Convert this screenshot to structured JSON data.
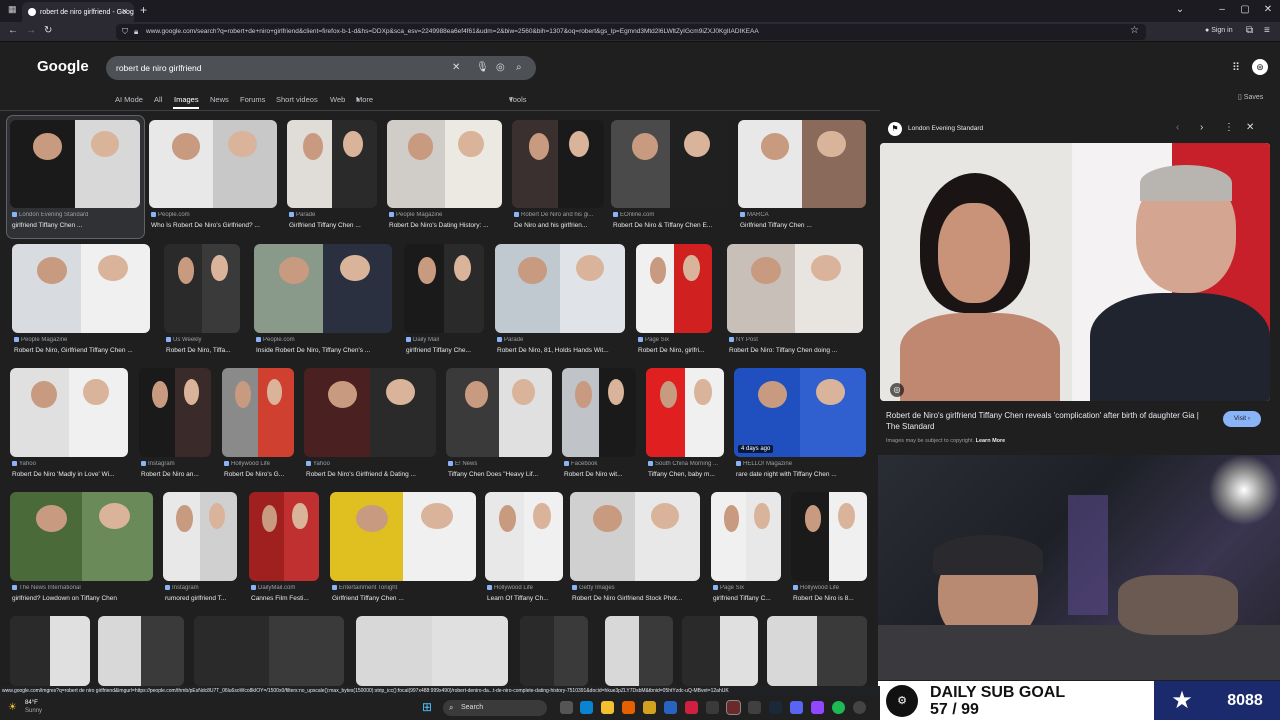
{
  "browser": {
    "tab_title": "robert de niro girlfriend - Goog",
    "url": "www.google.com/search?q=robert+de+niro+girlfriend&client=firefox-b-1-d&hs=DDXp&sca_esv=2249988ea6ef4f61&udm=2&biw=2560&bih=1307&oq=robert&gs_lp=Egmnd3Mtd2l6LWltZyIGcm9iZXJ0KgIIADIKEAA",
    "signin": "Sign in"
  },
  "google": {
    "logo": "Google",
    "query": "robert de niro girlfriend",
    "tabs": [
      "AI Mode",
      "All",
      "Images",
      "News",
      "Forums",
      "Short videos",
      "Web",
      "More"
    ],
    "active_tab": "Images",
    "tools": "Tools",
    "saves": "Saves"
  },
  "results": [
    {
      "source": "London Evening Standard",
      "caption": "girlfriend Tiffany Chen ...",
      "c1": "#1a1a1a",
      "c2": "#d8d8d8"
    },
    {
      "source": "People.com",
      "caption": "Who Is Robert De Niro's Girlfriend? ...",
      "c1": "#e8e8e8",
      "c2": "#c8c8c8"
    },
    {
      "source": "Parade",
      "caption": "Girlfriend Tiffany Chen ...",
      "c1": "#e0ddd8",
      "c2": "#2a2a2a"
    },
    {
      "source": "People Magazine",
      "caption": "Robert De Niro's Dating History: ...",
      "c1": "#d0ccc8",
      "c2": "#ece8e2"
    },
    {
      "source": "Robert De Niro and his gi...",
      "caption": "De Niro and his girlfrien...",
      "c1": "#3a3030",
      "c2": "#1a1a1a"
    },
    {
      "source": "EOnline.com",
      "caption": "Robert De Niro & Tiffany Chen E...",
      "c1": "#4a4a4a",
      "c2": "#202020"
    },
    {
      "source": "MARCA",
      "caption": "Girlfriend Tiffany Chen ...",
      "c1": "#e8e8e8",
      "c2": "#8a6a5a"
    },
    {
      "source": "People Magazine",
      "caption": "Robert De Niro, Girlfriend Tiffany Chen ...",
      "c1": "#d8dce0",
      "c2": "#f0f0f0"
    },
    {
      "source": "Us Weekly",
      "caption": "Robert De Niro, Tiffa...",
      "c1": "#2a2a2a",
      "c2": "#3a3a3a"
    },
    {
      "source": "People.com",
      "caption": "Inside Robert De Niro, Tiffany Chen's ...",
      "c1": "#8a9a8a",
      "c2": "#2a3040"
    },
    {
      "source": "Daily Mail",
      "caption": "girlfriend Tiffany Che...",
      "c1": "#1a1a1a",
      "c2": "#2a2a2a"
    },
    {
      "source": "Parade",
      "caption": "Robert De Niro, 81, Holds Hands Wit...",
      "c1": "#c0c8d0",
      "c2": "#e0e4e8"
    },
    {
      "source": "Page Six",
      "caption": "Robert De Niro, girlfri...",
      "c1": "#f0f0f0",
      "c2": "#d02020"
    },
    {
      "source": "NY Post",
      "caption": "Robert De Niro: Tiffany Chen doing ...",
      "c1": "#c8c0b8",
      "c2": "#e8e4e0"
    },
    {
      "source": "Yahoo",
      "caption": "Robert De Niro 'Madly in Love' Wi...",
      "c1": "#e0e0e0",
      "c2": "#f0f0f0"
    },
    {
      "source": "Instagram",
      "caption": "Robert De Niro an...",
      "c1": "#1a1a1a",
      "c2": "#3a2a2a"
    },
    {
      "source": "Hollywood Life",
      "caption": "Robert De Niro's G...",
      "c1": "#8a8a8a",
      "c2": "#d04030"
    },
    {
      "source": "Yahoo",
      "caption": "Robert De Niro's Girlfriend & Dating ...",
      "c1": "#4a2020",
      "c2": "#2a2a2a"
    },
    {
      "source": "E! News",
      "caption": "Tiffany Chen Does \"Heavy Lif...",
      "c1": "#3a3a3a",
      "c2": "#e0e0e0"
    },
    {
      "source": "Facebook",
      "caption": "Robert De Niro wit...",
      "c1": "#c0c4c8",
      "c2": "#1a1a1a"
    },
    {
      "source": "South China Morning ...",
      "caption": "Tiffany Chen, baby m...",
      "c1": "#e02020",
      "c2": "#f0f0f0"
    },
    {
      "source": "HELLO! Magazine",
      "caption": "rare date night with Tiffany Chen ...",
      "c1": "#2050c0",
      "c2": "#3060d0"
    },
    {
      "source": "The News International",
      "caption": "girlfriend? Lowdown on Tiffany Chen",
      "c1": "#4a6a3a",
      "c2": "#6a8a5a"
    },
    {
      "source": "Instagram",
      "caption": "rumored girlfriend T...",
      "c1": "#e8e8e8",
      "c2": "#d0d0d0"
    },
    {
      "source": "DailyMail.com",
      "caption": "Cannes Film Festi...",
      "c1": "#a02020",
      "c2": "#c03030"
    },
    {
      "source": "Entertainment Tonight",
      "caption": "Girlfriend Tiffany Chen ...",
      "c1": "#e0c020",
      "c2": "#f0f0f0"
    },
    {
      "source": "Hollywood Life",
      "caption": "Learn Of Tiffany Ch...",
      "c1": "#e8e8e8",
      "c2": "#f0f0f0"
    },
    {
      "source": "Getty Images",
      "caption": "Robert De Niro Girlfriend Stock Phot...",
      "c1": "#d0d0d0",
      "c2": "#e8e8e8"
    },
    {
      "source": "Page Six",
      "caption": "girlfriend Tiffany C...",
      "c1": "#f0f0f0",
      "c2": "#e8e8e8"
    },
    {
      "source": "Hollywood Life",
      "caption": "Robert De Niro is 8...",
      "c1": "#1a1a1a",
      "c2": "#f0f0f0"
    }
  ],
  "preview": {
    "source": "London Evening Standard",
    "caption": "Robert de Niro's girlfriend Tiffany Chen reveals 'complication' after birth of daughter Gia | The Standard",
    "note": "Images may be subject to copyright.",
    "learn_more": "Learn More",
    "visit": "Visit"
  },
  "overlay": {
    "label": "DAILY SUB GOAL",
    "progress": "57 / 99",
    "count": "8088"
  },
  "status_url": "www.google.com/imgres?q=robert de niro girlfriend&imgurl=https://people.com/thmb/pEsNdc8U7T_06lu6soWco8kIOY=/1500x0/filters:no_upscale():max_bytes(150000):strip_icc():focal(997x488:999x490)/robert-deniro-da...t-de-niro-complete-dating-history-7510391&docid=hkue3pZLY7DsbM&tbnid=05htYzdc-uQ-MBvet=12ahUK",
  "taskbar": {
    "temp": "84°F",
    "weather": "Sunny",
    "search": "Search"
  },
  "badges": {
    "days_ago": "4 days ago"
  }
}
